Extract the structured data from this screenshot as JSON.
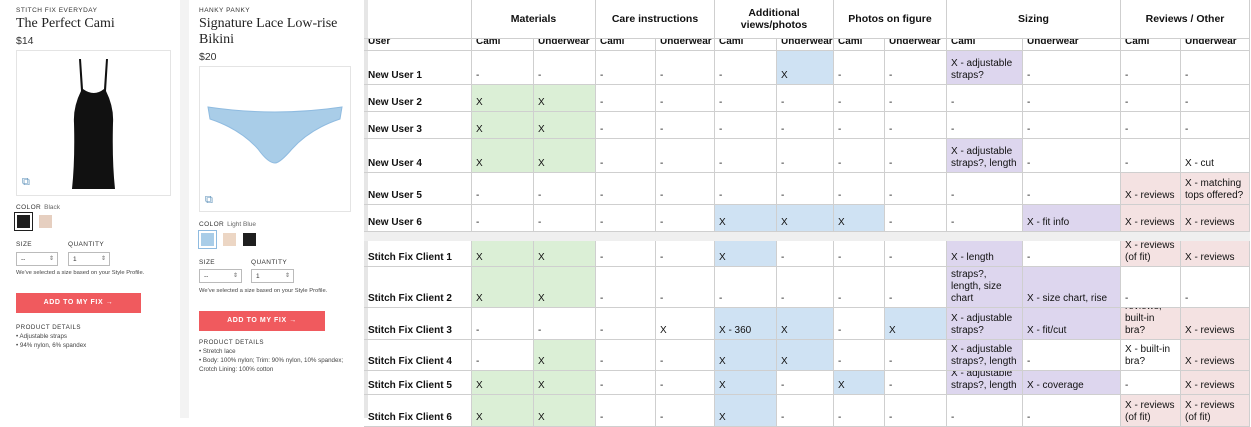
{
  "products": [
    {
      "brand": "STITCH FIX EVERYDAY",
      "name": "The Perfect Cami",
      "price": "$14",
      "color_label": "COLOR",
      "color_value": "Black",
      "size_label": "SIZE",
      "size_value": "--",
      "quantity_label": "QUANTITY",
      "quantity_value": "1",
      "note": "We've selected a size based on your Style Profile.",
      "button": "ADD TO MY FIX",
      "details_heading": "PRODUCT DETAILS",
      "details": [
        "Adjustable straps",
        "94% nylon, 6% spandex"
      ],
      "swatches": [
        "#1f1f1f",
        "#e6cfc0"
      ]
    },
    {
      "brand": "HANKY PANKY",
      "name": "Signature Lace Low-rise Bikini",
      "price": "$20",
      "color_label": "COLOR",
      "color_value": "Light Blue",
      "size_label": "SIZE",
      "size_value": "--",
      "quantity_label": "QUANTITY",
      "quantity_value": "1",
      "note": "We've selected a size based on your Style Profile.",
      "button": "ADD TO MY FIX",
      "details_heading": "PRODUCT DETAILS",
      "details": [
        "Stretch lace",
        "Body: 100% nylon; Trim: 90% nylon, 10% spandex; Crotch Lining: 100% cotton"
      ],
      "swatches": [
        "#a9cde8",
        "#ecd6c4",
        "#1f1f1f"
      ]
    }
  ],
  "table": {
    "groups": [
      "Materials",
      "Care instructions",
      "Additional views/photos",
      "Photos on figure",
      "Sizing",
      "Reviews / Other"
    ],
    "user_header": "User",
    "sub_headers": [
      "Cami",
      "Underwear"
    ],
    "rows": [
      {
        "user": "New User 1",
        "cells": [
          "-",
          "-",
          "-",
          "-",
          "-",
          "X",
          "-",
          "-",
          "X - adjustable straps?",
          "-",
          "-",
          "-"
        ],
        "colors": [
          "",
          "",
          "",
          "",
          "",
          "blue",
          "",
          "",
          "purple",
          "",
          "",
          ""
        ]
      },
      {
        "user": "New User 2",
        "cells": [
          "X",
          "X",
          "-",
          "-",
          "-",
          "-",
          "-",
          "-",
          "-",
          "-",
          "-",
          "-"
        ],
        "colors": [
          "green",
          "green",
          "",
          "",
          "",
          "",
          "",
          "",
          "",
          "",
          "",
          ""
        ]
      },
      {
        "user": "New User 3",
        "cells": [
          "X",
          "X",
          "-",
          "-",
          "-",
          "-",
          "-",
          "-",
          "-",
          "-",
          "-",
          "-"
        ],
        "colors": [
          "green",
          "green",
          "",
          "",
          "",
          "",
          "",
          "",
          "",
          "",
          "",
          ""
        ]
      },
      {
        "user": "New User 4",
        "cells": [
          "X",
          "X",
          "-",
          "-",
          "-",
          "-",
          "-",
          "-",
          "X - adjustable straps?, length",
          "-",
          "-",
          "X - cut"
        ],
        "colors": [
          "green",
          "green",
          "",
          "",
          "",
          "",
          "",
          "",
          "purple",
          "",
          "",
          ""
        ]
      },
      {
        "user": "New User 5",
        "cells": [
          "-",
          "-",
          "-",
          "-",
          "-",
          "-",
          "-",
          "-",
          "-",
          "-",
          "X - reviews",
          "X - matching tops offered?"
        ],
        "colors": [
          "",
          "",
          "",
          "",
          "",
          "",
          "",
          "",
          "",
          "",
          "pink",
          "pink"
        ]
      },
      {
        "user": "New User 6",
        "cells": [
          "-",
          "-",
          "-",
          "-",
          "X",
          "X",
          "X",
          "-",
          "-",
          "X - fit info",
          "X - reviews",
          "X - reviews"
        ],
        "colors": [
          "",
          "",
          "",
          "",
          "blue",
          "blue",
          "blue",
          "",
          "",
          "purple",
          "pink",
          "pink"
        ]
      },
      {
        "user": "Stitch Fix Client 1",
        "cells": [
          "X",
          "X",
          "-",
          "-",
          "X",
          "-",
          "-",
          "-",
          "X - length",
          "-",
          "X - reviews (of fit)",
          "X - reviews"
        ],
        "colors": [
          "green",
          "green",
          "",
          "",
          "blue",
          "",
          "",
          "",
          "purple",
          "",
          "pink",
          "pink"
        ]
      },
      {
        "user": "Stitch Fix Client 2",
        "cells": [
          "X",
          "X",
          "-",
          "-",
          "-",
          "-",
          "-",
          "-",
          "X - adjustable straps?, length, size chart",
          "X - size chart, rise",
          "-",
          "-"
        ],
        "colors": [
          "green",
          "green",
          "",
          "",
          "",
          "",
          "",
          "",
          "purple",
          "purple",
          "",
          ""
        ]
      },
      {
        "user": "Stitch Fix Client 3",
        "cells": [
          "-",
          "-",
          "-",
          "X",
          "X - 360",
          "X",
          "-",
          "X",
          "X - adjustable straps?",
          "X - fit/cut",
          "X - reviews, built-in bra?",
          "X - reviews"
        ],
        "colors": [
          "",
          "",
          "",
          "",
          "blue",
          "blue",
          "",
          "blue",
          "purple",
          "purple",
          "pink",
          "pink"
        ]
      },
      {
        "user": "Stitch Fix Client 4",
        "cells": [
          "-",
          "X",
          "-",
          "-",
          "X",
          "X",
          "-",
          "-",
          "X - adjustable straps?, length",
          "-",
          "X - built-in bra?",
          "X - reviews"
        ],
        "colors": [
          "",
          "green",
          "",
          "",
          "blue",
          "blue",
          "",
          "",
          "purple",
          "",
          "",
          "pink"
        ]
      },
      {
        "user": "Stitch Fix Client 5",
        "cells": [
          "X",
          "X",
          "-",
          "-",
          "X",
          "-",
          "X",
          "-",
          "X - adjustable straps?, length",
          "X - coverage",
          "-",
          "X - reviews"
        ],
        "colors": [
          "green",
          "green",
          "",
          "",
          "blue",
          "",
          "blue",
          "",
          "purple",
          "purple",
          "",
          "pink"
        ]
      },
      {
        "user": "Stitch Fix Client 6",
        "cells": [
          "X",
          "X",
          "-",
          "-",
          "X",
          "-",
          "-",
          "-",
          "-",
          "-",
          "X - reviews (of fit)",
          "X - reviews (of fit)"
        ],
        "colors": [
          "green",
          "green",
          "",
          "",
          "blue",
          "",
          "",
          "",
          "",
          "",
          "pink",
          "pink"
        ]
      }
    ]
  },
  "colors": {
    "green": "#dbefd6",
    "blue": "#cfe2f3",
    "purple": "#ddd6ee",
    "pink": "#f4e2e2",
    "button": "#f05a5e"
  }
}
